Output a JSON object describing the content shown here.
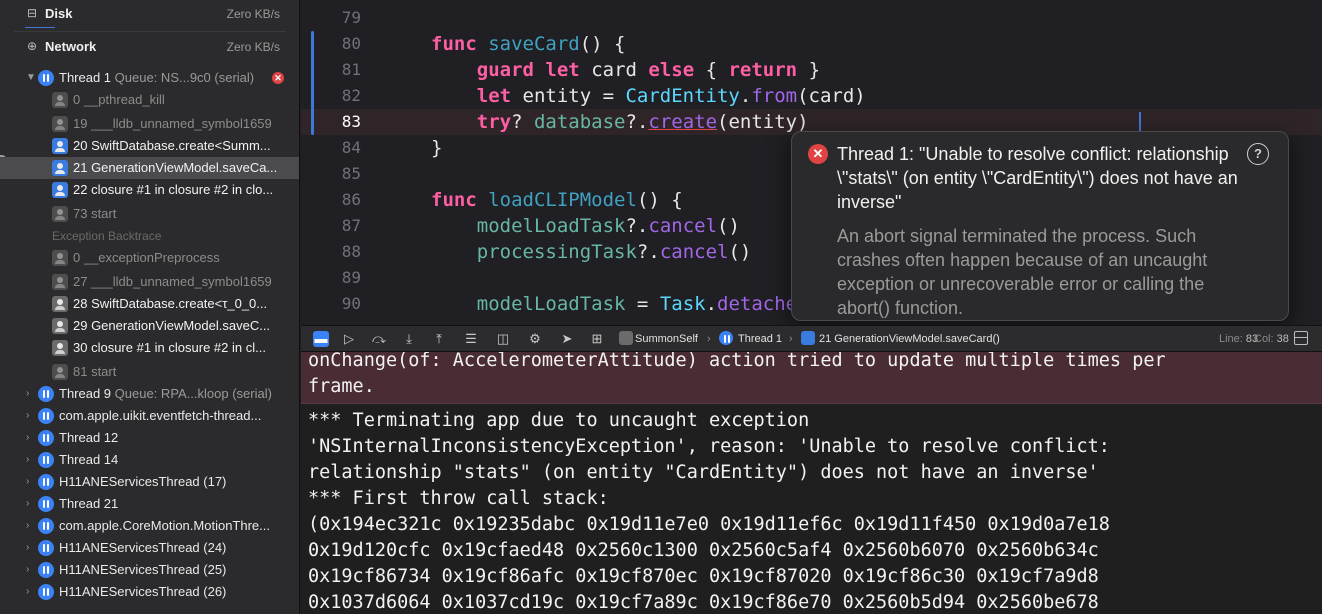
{
  "navigator": {
    "gauges": [
      {
        "label": "Disk",
        "value": "Zero KB/s",
        "icon": "disk-icon"
      },
      {
        "label": "Network",
        "value": "Zero KB/s",
        "icon": "globe-icon"
      }
    ],
    "thread1": {
      "label": "Thread 1",
      "queue": "Queue: NS...9c0 (serial)",
      "has_error": true
    },
    "thread1_frames": [
      {
        "label": "0 __pthread_kill",
        "kind": "sys"
      },
      {
        "label": "19 ___lldb_unnamed_symbol1659",
        "kind": "sys"
      },
      {
        "label": "20 SwiftDatabase.create<Summ...",
        "kind": "user"
      },
      {
        "label": "21 GenerationViewModel.saveCa...",
        "kind": "user",
        "selected": true
      },
      {
        "label": "22 closure #1 in closure #2 in clo...",
        "kind": "user"
      },
      {
        "label": "73 start",
        "kind": "sys"
      }
    ],
    "exception_header": "Exception Backtrace",
    "exception_frames": [
      {
        "label": "0 __exceptionPreprocess",
        "kind": "sys"
      },
      {
        "label": "27 ___lldb_unnamed_symbol1659",
        "kind": "sys"
      },
      {
        "label": "28 SwiftDatabase.create<τ_0_0...",
        "kind": "user"
      },
      {
        "label": "29 GenerationViewModel.saveC...",
        "kind": "user"
      },
      {
        "label": "30 closure #1 in closure #2 in cl...",
        "kind": "user"
      },
      {
        "label": "81 start",
        "kind": "sys"
      }
    ],
    "other_threads": [
      {
        "label": "Thread 9",
        "queue": "Queue: RPA...kloop (serial)"
      },
      {
        "label": "com.apple.uikit.eventfetch-thread...",
        "queue": ""
      },
      {
        "label": "Thread 12",
        "queue": ""
      },
      {
        "label": "Thread 14",
        "queue": ""
      },
      {
        "label": "H11ANEServicesThread (17)",
        "queue": ""
      },
      {
        "label": "Thread 21",
        "queue": ""
      },
      {
        "label": "com.apple.CoreMotion.MotionThre...",
        "queue": ""
      },
      {
        "label": "H11ANEServicesThread (24)",
        "queue": ""
      },
      {
        "label": "H11ANEServicesThread (25)",
        "queue": ""
      },
      {
        "label": "H11ANEServicesThread (26)",
        "queue": ""
      }
    ]
  },
  "editor": {
    "line_numbers": [
      "79",
      "80",
      "81",
      "82",
      "83",
      "84",
      "85",
      "86",
      "87",
      "88",
      "89",
      "90"
    ],
    "current_line": "83"
  },
  "popover": {
    "title": "Thread 1: \"Unable to resolve conflict: relationship \\\"stats\\\" (on entity \\\"CardEntity\\\") does not have an inverse\"",
    "description": "An abort signal terminated the process. Such crashes often happen because of an uncaught exception or unrecoverable error or calling the abort() function.",
    "help": "?"
  },
  "debugbar": {
    "crumbs": [
      "SummonSelf",
      "Thread 1",
      "21 GenerationViewModel.saveCard()"
    ],
    "line_label": "Line:",
    "line_value": "83",
    "col_label": "Col:",
    "col_value": "38"
  },
  "console": {
    "warning_lines": [
      "onChange(of: AccelerometerAttitude) action tried to update multiple times per",
      "frame."
    ],
    "lines": [
      "*** Terminating app due to uncaught exception",
      "'NSInternalInconsistencyException', reason: 'Unable to resolve conflict:",
      "relationship \"stats\" (on entity \"CardEntity\") does not have an inverse'",
      "*** First throw call stack:",
      "(0x194ec321c 0x19235dabc 0x19d11e7e0 0x19d11ef6c 0x19d11f450 0x19d0a7e18",
      "0x19d120cfc 0x19cfaed48 0x2560c1300 0x2560c5af4 0x2560b6070 0x2560b634c",
      "0x19cf86734 0x19cf86afc 0x19cf870ec 0x19cf87020 0x19cf86c30 0x19cf7a9d8",
      "0x1037d6064 0x1037cd19c 0x19cf7a89c 0x19cf86e70 0x2560b5d94 0x2560be678"
    ]
  },
  "colors": {
    "accent": "#3b82f6",
    "error": "#e04343",
    "keyword": "#fc5fa3",
    "type": "#5dd8ff"
  }
}
